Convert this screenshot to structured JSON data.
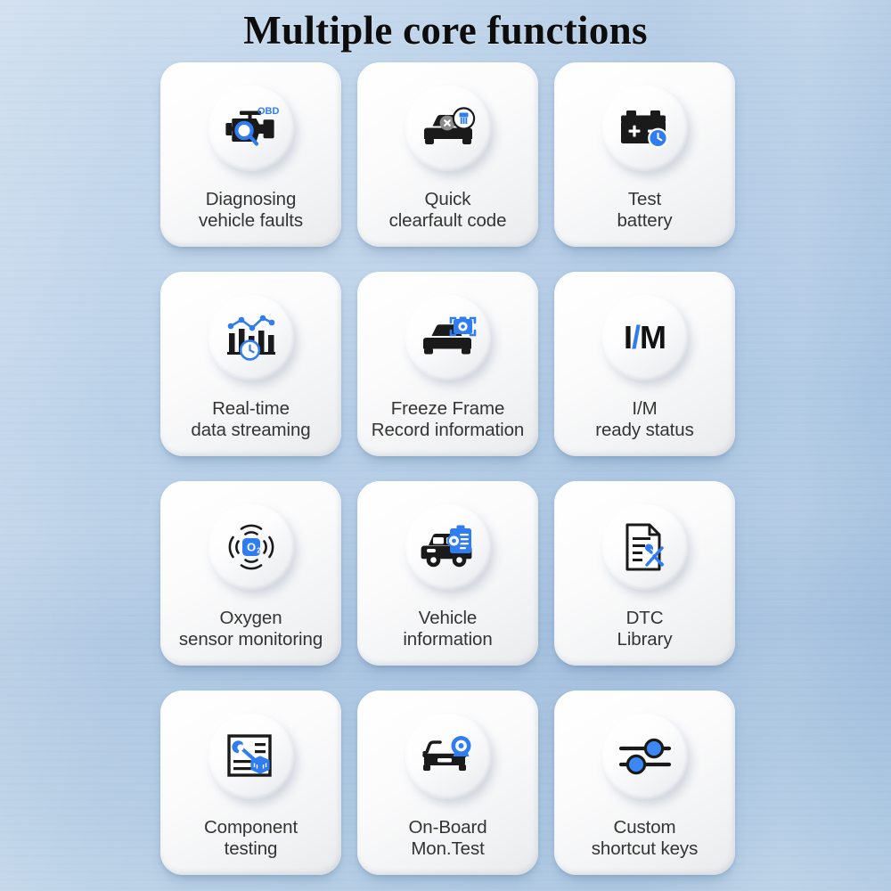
{
  "header": {
    "title": "Multiple core functions"
  },
  "theme": {
    "accent_blue": "#2f7df0",
    "icon_ink": "#1a1a1a",
    "label_color": "#343434",
    "card_surface": "#ffffff",
    "background_blue": "#b2cbe6"
  },
  "cards": [
    {
      "icon": "engine-obd-magnifier-icon",
      "line1": "Diagnosing",
      "line2": "vehicle faults",
      "badge_text": "OBD"
    },
    {
      "icon": "car-clear-code-brush-icon",
      "line1": "Quick",
      "line2": "clearfault code"
    },
    {
      "icon": "battery-clock-icon",
      "line1": "Test",
      "line2": "battery"
    },
    {
      "icon": "bar-chart-line-clock-icon",
      "line1": "Real-time",
      "line2": "data streaming"
    },
    {
      "icon": "car-camera-frame-icon",
      "line1": "Freeze Frame",
      "line2": "Record information"
    },
    {
      "icon": "im-text-icon",
      "icon_label": "I/M",
      "line1": "I/M",
      "line2": "ready status"
    },
    {
      "icon": "oxygen-sensor-signal-icon",
      "icon_label": "O2",
      "line1": "Oxygen",
      "line2": "sensor monitoring"
    },
    {
      "icon": "car-clipboard-info-icon",
      "line1": "Vehicle",
      "line2": "information"
    },
    {
      "icon": "document-tools-icon",
      "line1": "DTC",
      "line2": "Library"
    },
    {
      "icon": "document-wrench-box-icon",
      "line1": "Component",
      "line2": "testing"
    },
    {
      "icon": "car-monitor-camera-icon",
      "line1": "On-Board",
      "line2": "Mon.Test"
    },
    {
      "icon": "sliders-settings-icon",
      "line1": "Custom",
      "line2": "shortcut keys"
    }
  ]
}
